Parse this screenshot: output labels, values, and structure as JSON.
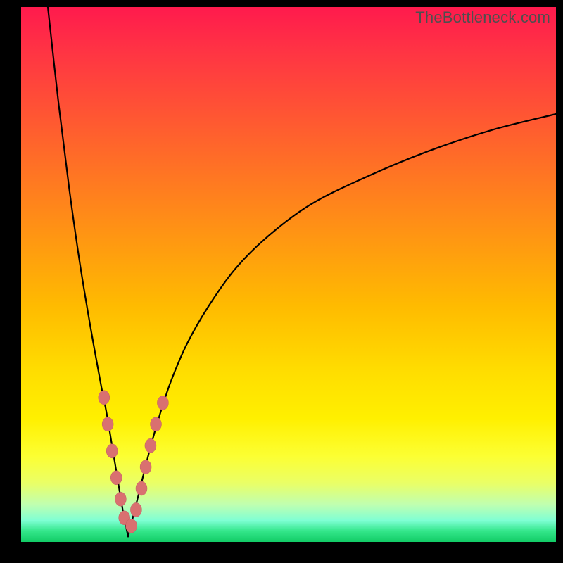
{
  "watermark": "TheBottleneck.com",
  "colors": {
    "frame": "#000000",
    "curve": "#000000",
    "marker_fill": "#d97070",
    "marker_stroke": "#c06060",
    "gradient_top": "#ff1a4d",
    "gradient_bottom": "#12cc66"
  },
  "chart_data": {
    "type": "line",
    "title": "",
    "xlabel": "",
    "ylabel": "",
    "xlim": [
      0,
      100
    ],
    "ylim": [
      0,
      100
    ],
    "notes": "V-shaped bottleneck curve. y ≈ |x − 20| style cusp near x≈20 reaching y≈0 (green zone), rising steeply to left edge (~100 at x≈5) and asymptotically to ~80 at right edge. Pink markers cluster on both branches near the cusp between y≈5 and y≈28.",
    "series": [
      {
        "name": "left-branch",
        "x": [
          5,
          7,
          9,
          11,
          13,
          15,
          16,
          17,
          18,
          19,
          20
        ],
        "y": [
          100,
          82,
          66,
          52,
          40,
          29,
          24,
          18,
          12,
          6,
          1
        ]
      },
      {
        "name": "right-branch",
        "x": [
          20,
          22,
          24,
          26,
          28,
          31,
          35,
          40,
          46,
          54,
          64,
          76,
          88,
          100
        ],
        "y": [
          1,
          9,
          17,
          24,
          30,
          37,
          44,
          51,
          57,
          63,
          68,
          73,
          77,
          80
        ]
      }
    ],
    "markers": [
      {
        "branch": "left",
        "x": 15.5,
        "y": 27
      },
      {
        "branch": "left",
        "x": 16.2,
        "y": 22
      },
      {
        "branch": "left",
        "x": 17.0,
        "y": 17
      },
      {
        "branch": "left",
        "x": 17.8,
        "y": 12
      },
      {
        "branch": "left",
        "x": 18.6,
        "y": 8
      },
      {
        "branch": "left",
        "x": 19.3,
        "y": 4.5
      },
      {
        "branch": "right",
        "x": 20.6,
        "y": 3
      },
      {
        "branch": "right",
        "x": 21.5,
        "y": 6
      },
      {
        "branch": "right",
        "x": 22.5,
        "y": 10
      },
      {
        "branch": "right",
        "x": 23.3,
        "y": 14
      },
      {
        "branch": "right",
        "x": 24.2,
        "y": 18
      },
      {
        "branch": "right",
        "x": 25.2,
        "y": 22
      },
      {
        "branch": "right",
        "x": 26.5,
        "y": 26
      }
    ]
  }
}
